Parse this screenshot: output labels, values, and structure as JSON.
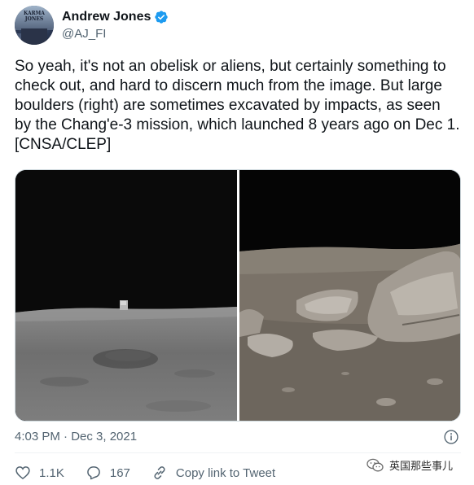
{
  "author": {
    "display_name": "Andrew Jones",
    "handle": "@AJ_FI",
    "avatar_text": "KARMA JONES",
    "verified": true
  },
  "tweet": {
    "text": "So yeah, it's not an obelisk or aliens, but certainly something to check out, and hard to discern much from the image. But large boulders (right) are sometimes excavated by impacts, as seen by the Chang'e-3 mission, which launched 8 years ago on Dec 1. [CNSA/CLEP]",
    "timestamp": "4:03 PM · Dec 3, 2021"
  },
  "actions": {
    "likes": "1.1K",
    "replies": "167",
    "share_label": "Copy link to Tweet"
  },
  "watermark": {
    "text": "英国那些事儿"
  },
  "colors": {
    "verified_blue": "#1d9bf0",
    "secondary_text": "#536471"
  },
  "icons": [
    "verified-icon",
    "info-icon",
    "heart-icon",
    "reply-icon",
    "link-icon",
    "wechat-icon"
  ]
}
